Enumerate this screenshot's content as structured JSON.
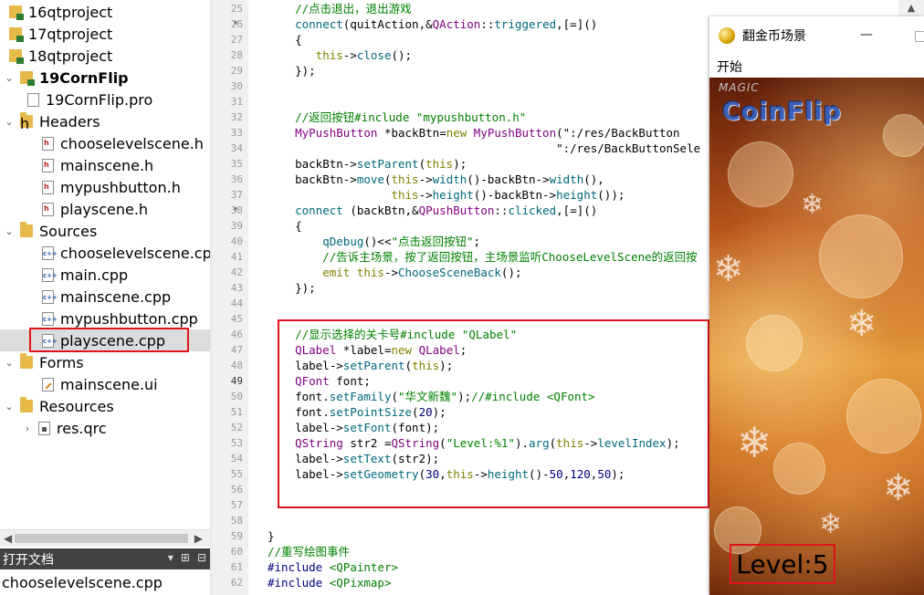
{
  "project_tree": {
    "items": [
      {
        "label": "16qtproject",
        "icon": "qt-project-icon",
        "bold": false
      },
      {
        "label": "17qtproject",
        "icon": "qt-project-icon",
        "bold": false
      },
      {
        "label": "18qtproject",
        "icon": "qt-project-icon",
        "bold": false
      },
      {
        "label": "19CornFlip",
        "icon": "qt-project-icon",
        "bold": true
      },
      {
        "label": "19CornFlip.pro",
        "icon": "pro-file-icon"
      },
      {
        "label": "Headers",
        "icon": "headers-folder-icon"
      },
      {
        "label": "chooselevelscene.h",
        "icon": "header-file-icon"
      },
      {
        "label": "mainscene.h",
        "icon": "header-file-icon"
      },
      {
        "label": "mypushbutton.h",
        "icon": "header-file-icon"
      },
      {
        "label": "playscene.h",
        "icon": "header-file-icon"
      },
      {
        "label": "Sources",
        "icon": "sources-folder-icon"
      },
      {
        "label": "chooselevelscene.cpp",
        "icon": "cpp-file-icon"
      },
      {
        "label": "main.cpp",
        "icon": "cpp-file-icon"
      },
      {
        "label": "mainscene.cpp",
        "icon": "cpp-file-icon"
      },
      {
        "label": "mypushbutton.cpp",
        "icon": "cpp-file-icon"
      },
      {
        "label": "playscene.cpp",
        "icon": "cpp-file-icon",
        "selected": true
      },
      {
        "label": "Forms",
        "icon": "forms-folder-icon"
      },
      {
        "label": "mainscene.ui",
        "icon": "ui-file-icon"
      },
      {
        "label": "Resources",
        "icon": "resources-folder-icon"
      },
      {
        "label": "res.qrc",
        "icon": "qrc-file-icon"
      }
    ]
  },
  "open_documents": {
    "title": "打开文档",
    "current": "chooselevelscene.cpp"
  },
  "editor": {
    "lines": [
      {
        "n": "25",
        "text": "    //点击退出，退出游戏"
      },
      {
        "n": "26",
        "text": "    connect(quitAction,&QAction::triggered,[=]()"
      },
      {
        "n": "27",
        "text": "    {"
      },
      {
        "n": "28",
        "text": "       this->close();"
      },
      {
        "n": "29",
        "text": "    });"
      },
      {
        "n": "30",
        "text": ""
      },
      {
        "n": "31",
        "text": ""
      },
      {
        "n": "32",
        "text": "    //返回按钮#include \"mypushbutton.h\""
      },
      {
        "n": "33",
        "text": "    MyPushButton *backBtn=new MyPushButton(\":/res/BackButton"
      },
      {
        "n": "34",
        "text": "                                          \":/res/BackButtonSele"
      },
      {
        "n": "35",
        "text": "    backBtn->setParent(this);"
      },
      {
        "n": "36",
        "text": "    backBtn->move(this->width()-backBtn->width(),"
      },
      {
        "n": "37",
        "text": "                  this->height()-backBtn->height());"
      },
      {
        "n": "38",
        "text": "    connect (backBtn,&QPushButton::clicked,[=]()"
      },
      {
        "n": "39",
        "text": "    {"
      },
      {
        "n": "40",
        "text": "        qDebug()<<\"点击返回按钮\";"
      },
      {
        "n": "41",
        "text": "        //告诉主场景，按了返回按钮，主场景监听ChooseLevelScene的返回按"
      },
      {
        "n": "42",
        "text": "        emit this->ChooseSceneBack();"
      },
      {
        "n": "43",
        "text": "    });"
      },
      {
        "n": "44",
        "text": ""
      },
      {
        "n": "45",
        "text": ""
      },
      {
        "n": "46",
        "text": "    //显示选择的关卡号#include \"QLabel\""
      },
      {
        "n": "47",
        "text": "    QLabel *label=new QLabel;"
      },
      {
        "n": "48",
        "text": "    label->setParent(this);"
      },
      {
        "n": "49",
        "text": "    QFont font;"
      },
      {
        "n": "50",
        "text": "    font.setFamily(\"华文新魏\");//#include <QFont>"
      },
      {
        "n": "51",
        "text": "    font.setPointSize(20);"
      },
      {
        "n": "52",
        "text": "    label->setFont(font);"
      },
      {
        "n": "53",
        "text": "    QString str2 =QString(\"Level:%1\").arg(this->levelIndex);"
      },
      {
        "n": "54",
        "text": "    label->setText(str2);"
      },
      {
        "n": "55",
        "text": "    label->setGeometry(30,this->height()-50,120,50);"
      },
      {
        "n": "56",
        "text": ""
      },
      {
        "n": "57",
        "text": ""
      },
      {
        "n": "58",
        "text": ""
      },
      {
        "n": "59",
        "text": "}"
      },
      {
        "n": "60",
        "text": "//重写绘图事件"
      },
      {
        "n": "61",
        "text": "#include <QPainter>"
      },
      {
        "n": "62",
        "text": "#include <QPixmap>"
      }
    ]
  },
  "game_window": {
    "title": "翻金币场景",
    "minimize": "—",
    "menu_start": "开始",
    "logo_small": "MAGIC",
    "logo": "CoinFlip",
    "level_label": "Level:5"
  },
  "colors": {
    "highlight_box": "#e0141e",
    "comment": "#008000",
    "keyword": "#808000",
    "type": "#800080",
    "function": "#00677c"
  }
}
